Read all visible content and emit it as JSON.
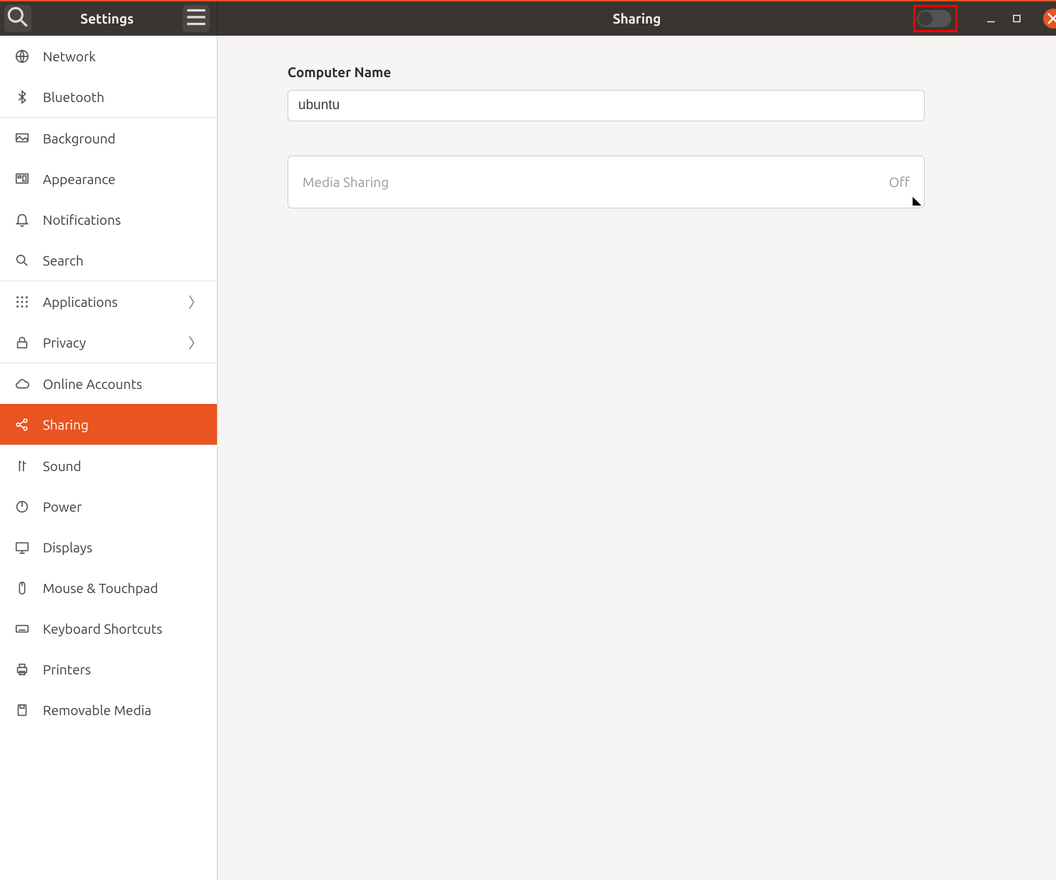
{
  "header": {
    "settings_title": "Settings",
    "page_title": "Sharing"
  },
  "sharing_toggle": {
    "state": "off"
  },
  "sidebar": {
    "items": [
      {
        "label": "Network",
        "icon": "globe-icon"
      },
      {
        "label": "Bluetooth",
        "icon": "bluetooth-icon"
      }
    ],
    "items2": [
      {
        "label": "Background",
        "icon": "background-icon"
      },
      {
        "label": "Appearance",
        "icon": "appearance-icon"
      },
      {
        "label": "Notifications",
        "icon": "bell-icon"
      },
      {
        "label": "Search",
        "icon": "search-icon"
      }
    ],
    "items3": [
      {
        "label": "Applications",
        "icon": "apps-icon",
        "chevron": true
      },
      {
        "label": "Privacy",
        "icon": "lock-icon",
        "chevron": true
      }
    ],
    "items4": [
      {
        "label": "Online Accounts",
        "icon": "cloud-icon"
      },
      {
        "label": "Sharing",
        "icon": "share-icon",
        "active": true
      }
    ],
    "items5": [
      {
        "label": "Sound",
        "icon": "sound-icon"
      },
      {
        "label": "Power",
        "icon": "power-icon"
      },
      {
        "label": "Displays",
        "icon": "display-icon"
      },
      {
        "label": "Mouse & Touchpad",
        "icon": "mouse-icon"
      },
      {
        "label": "Keyboard Shortcuts",
        "icon": "keyboard-icon"
      },
      {
        "label": "Printers",
        "icon": "printer-icon"
      },
      {
        "label": "Removable Media",
        "icon": "media-icon"
      }
    ]
  },
  "main": {
    "computer_name_label": "Computer Name",
    "computer_name_value": "ubuntu",
    "rows": [
      {
        "label": "Media Sharing",
        "status": "Off"
      }
    ]
  }
}
